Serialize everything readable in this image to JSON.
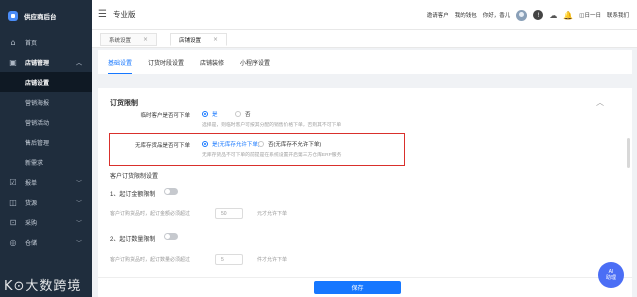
{
  "sidebar": {
    "logo_text": "供应商后台",
    "items": [
      {
        "icon": "home-icon",
        "glyph": "⌂",
        "label": "首页"
      },
      {
        "icon": "store-icon",
        "glyph": "▣",
        "label": "店铺管理",
        "arrow": "︿"
      }
    ],
    "sub_items": [
      "店铺设置",
      "营销海报",
      "营销活动",
      "售后管理",
      "新需求"
    ],
    "lower_items": [
      {
        "icon": "order-icon",
        "glyph": "☑",
        "label": "报单",
        "arrow": "﹀"
      },
      {
        "icon": "product-icon",
        "glyph": "◫",
        "label": "货源",
        "arrow": "﹀"
      },
      {
        "icon": "purchase-icon",
        "glyph": "⊡",
        "label": "采购",
        "arrow": "﹀"
      },
      {
        "icon": "warehouse-icon",
        "glyph": "◎",
        "label": "仓储",
        "arrow": "﹀"
      }
    ],
    "watermark": "K⊙大数跨境"
  },
  "topbar": {
    "menu_glyph": "☰",
    "edition": "专业版",
    "invite": "邀请客户",
    "wallet": "我的钱包",
    "greeting": "你好，香儿",
    "bell_glyph": "♫",
    "cloud_glyph": "☁",
    "info_glyph": "!",
    "chat_glyph": "🔔",
    "signin": "◫日一日",
    "contact": "联系我们"
  },
  "tabs": [
    {
      "label": "系统设置",
      "close": "×"
    },
    {
      "label": "店铺设置",
      "close": "×"
    }
  ],
  "subtabs": [
    "基础设置",
    "订货时段设置",
    "店铺装修",
    "小程序设置"
  ],
  "section": {
    "title": "订货限制",
    "collapse_glyph": "︿",
    "temp_customer": {
      "label": "临时客户是否可下单",
      "yes": "是",
      "no": "否",
      "hint": "选择是，则临时客户可按其分配的销售价格下单，否则其不可下单"
    },
    "no_stock": {
      "label": "无库存货品是否可下单",
      "yes": "是(无库存允许下单)",
      "no": "否(无库存不允许下单)",
      "hint": "无库存货品不可下单的前提是在系统设置开启第三方仓库ERP服务"
    },
    "rules_title": "客户订货限制设置",
    "rule1": {
      "title": "1、起订金额限制",
      "prefix": "客户订购货品时，起订金额必须超过",
      "value": "50",
      "suffix": "元才允许下单"
    },
    "rule2": {
      "title": "2、起订数量限制",
      "prefix": "客户订购货品时，起订数量必须超过",
      "value": "5",
      "suffix": "件才允许下单"
    }
  },
  "footer": {
    "save": "保存"
  },
  "ai_fab": {
    "line1": "AI",
    "line2": "助理"
  },
  "colors": {
    "accent": "#1677ff",
    "highlight": "#d9302c",
    "sidebar": "#1f2d3d"
  }
}
